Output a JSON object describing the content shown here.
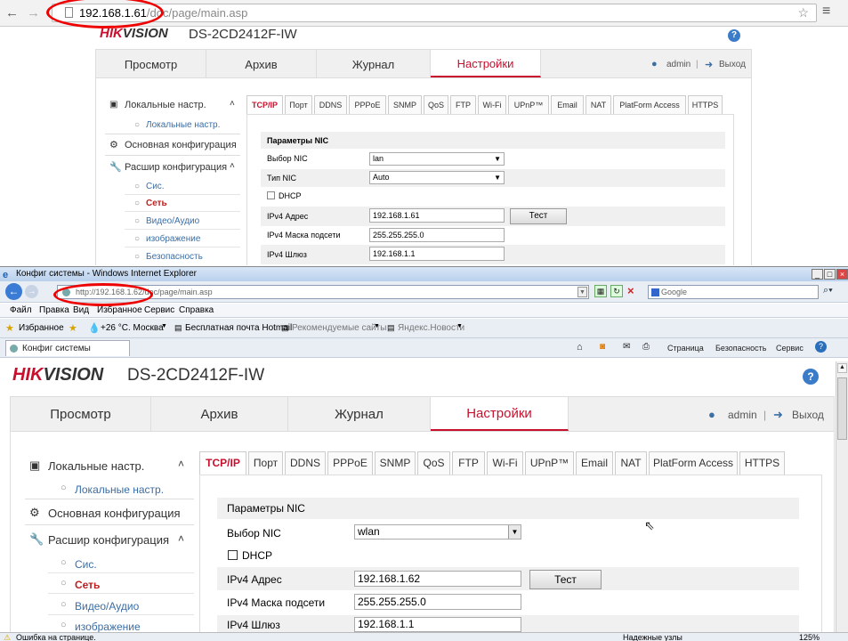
{
  "top": {
    "url_host": "192.168.1.61",
    "url_path": "/doc/page/main.asp",
    "logo": {
      "a": "HIK",
      "b": "VISION"
    },
    "model": "DS-2CD2412F-IW",
    "help": "?",
    "tabs": [
      "Просмотр",
      "Архив",
      "Журнал",
      "Настройки"
    ],
    "user": "admin",
    "sep": "|",
    "logout": "Выход",
    "side": {
      "local": "Локальные настр.",
      "local_sub": "Локальные настр.",
      "basic": "Основная конфигурация",
      "adv": "Расшир конфигурация",
      "subs": [
        "Сис.",
        "Сеть",
        "Видео/Аудио",
        "изображение",
        "Безопасность"
      ]
    },
    "subtabs": [
      "TCP/IP",
      "Порт",
      "DDNS",
      "PPPoE",
      "SNMP",
      "QoS",
      "FTP",
      "Wi-Fi",
      "UPnP™",
      "Email",
      "NAT",
      "PlatForm Access",
      "HTTPS"
    ],
    "section": "Параметры NIC",
    "labels": {
      "nic": "Выбор NIC",
      "type": "Тип NIC",
      "dhcp": "DHCP",
      "ipv4": "IPv4 Адрес",
      "mask": "IPv4 Маска подсети",
      "gw": "IPv4 Шлюз"
    },
    "values": {
      "nic": "lan",
      "type": "Auto",
      "ipv4": "192.168.1.61",
      "mask": "255.255.255.0",
      "gw": "192.168.1.1"
    },
    "test": "Тест"
  },
  "ie": {
    "title": "Конфиг системы - Windows Internet Explorer",
    "url_host": "http://192.168.1.62",
    "url_path": "/doc/page/main.asp",
    "search_placeholder": "Google",
    "menu": [
      "Файл",
      "Правка",
      "Вид",
      "Избранное",
      "Сервис",
      "Справка"
    ],
    "favorites": "Избранное",
    "weather": "+26 °C. Москва",
    "fav_links": [
      "Бесплатная почта Hotmail",
      "Рекомендуемые сайты",
      "Яндекс.Новости"
    ],
    "tab_title": "Конфиг системы",
    "cmd": [
      "Страница",
      "Безопасность",
      "Сервис"
    ],
    "status_left": "Ошибка на странице.",
    "status_zone": "Надежные узлы",
    "zoom": "125%"
  },
  "bottom": {
    "logo": {
      "a": "HIK",
      "b": "VISION"
    },
    "model": "DS-2CD2412F-IW",
    "help": "?",
    "tabs": [
      "Просмотр",
      "Архив",
      "Журнал",
      "Настройки"
    ],
    "user": "admin",
    "sep": "|",
    "logout": "Выход",
    "side": {
      "local": "Локальные настр.",
      "local_sub": "Локальные настр.",
      "basic": "Основная конфигурация",
      "adv": "Расшир конфигурация",
      "subs": [
        "Сис.",
        "Сеть",
        "Видео/Аудио",
        "изображение"
      ]
    },
    "subtabs": [
      "TCP/IP",
      "Порт",
      "DDNS",
      "PPPoE",
      "SNMP",
      "QoS",
      "FTP",
      "Wi-Fi",
      "UPnP™",
      "Email",
      "NAT",
      "PlatForm Access",
      "HTTPS"
    ],
    "section": "Параметры NIC",
    "labels": {
      "nic": "Выбор NIC",
      "dhcp": "DHCP",
      "ipv4": "IPv4 Адрес",
      "mask": "IPv4 Маска подсети",
      "gw": "IPv4 Шлюз"
    },
    "values": {
      "nic": "wlan",
      "ipv4": "192.168.1.62",
      "mask": "255.255.255.0",
      "gw": "192.168.1.1"
    },
    "test": "Тест"
  }
}
